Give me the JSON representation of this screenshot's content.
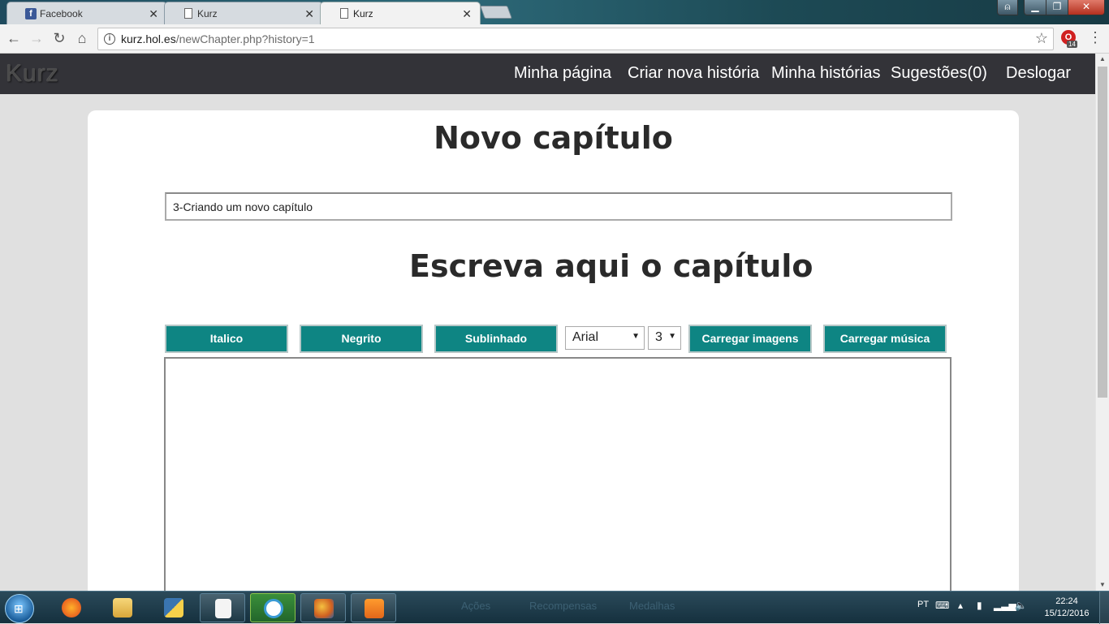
{
  "browser": {
    "tabs": [
      {
        "label": "Facebook",
        "icon": "facebook-icon"
      },
      {
        "label": "Kurz",
        "icon": "document-icon"
      },
      {
        "label": "Kurz",
        "icon": "document-icon"
      }
    ],
    "url_host": "kurz.hol.es",
    "url_path": "/newChapter.php?history=1",
    "extension_badge": "14"
  },
  "site": {
    "logo": "Kurz",
    "nav": {
      "my_page": "Minha página",
      "new_story": "Criar nova história",
      "my_stories": "Minha histórias",
      "suggestions": "Sugestões(0)",
      "logout": "Deslogar"
    }
  },
  "page": {
    "title": "Novo capítulo",
    "chapter_title_value": "3-Criando um novo capítulo",
    "editor_heading": "Escreva aqui o capítulo",
    "toolbar": {
      "italic": "Italico",
      "bold": "Negrito",
      "underline": "Sublinhado",
      "font_value": "Arial",
      "size_value": "3",
      "upload_images": "Carregar imagens",
      "upload_music": "Carregar música"
    },
    "accent_color": "#0e8583"
  },
  "taskbar": {
    "background_texts": [
      "Ações",
      "Recompensas",
      "Medalhas"
    ],
    "language": "PT",
    "time": "22:24",
    "date": "15/12/2016"
  }
}
